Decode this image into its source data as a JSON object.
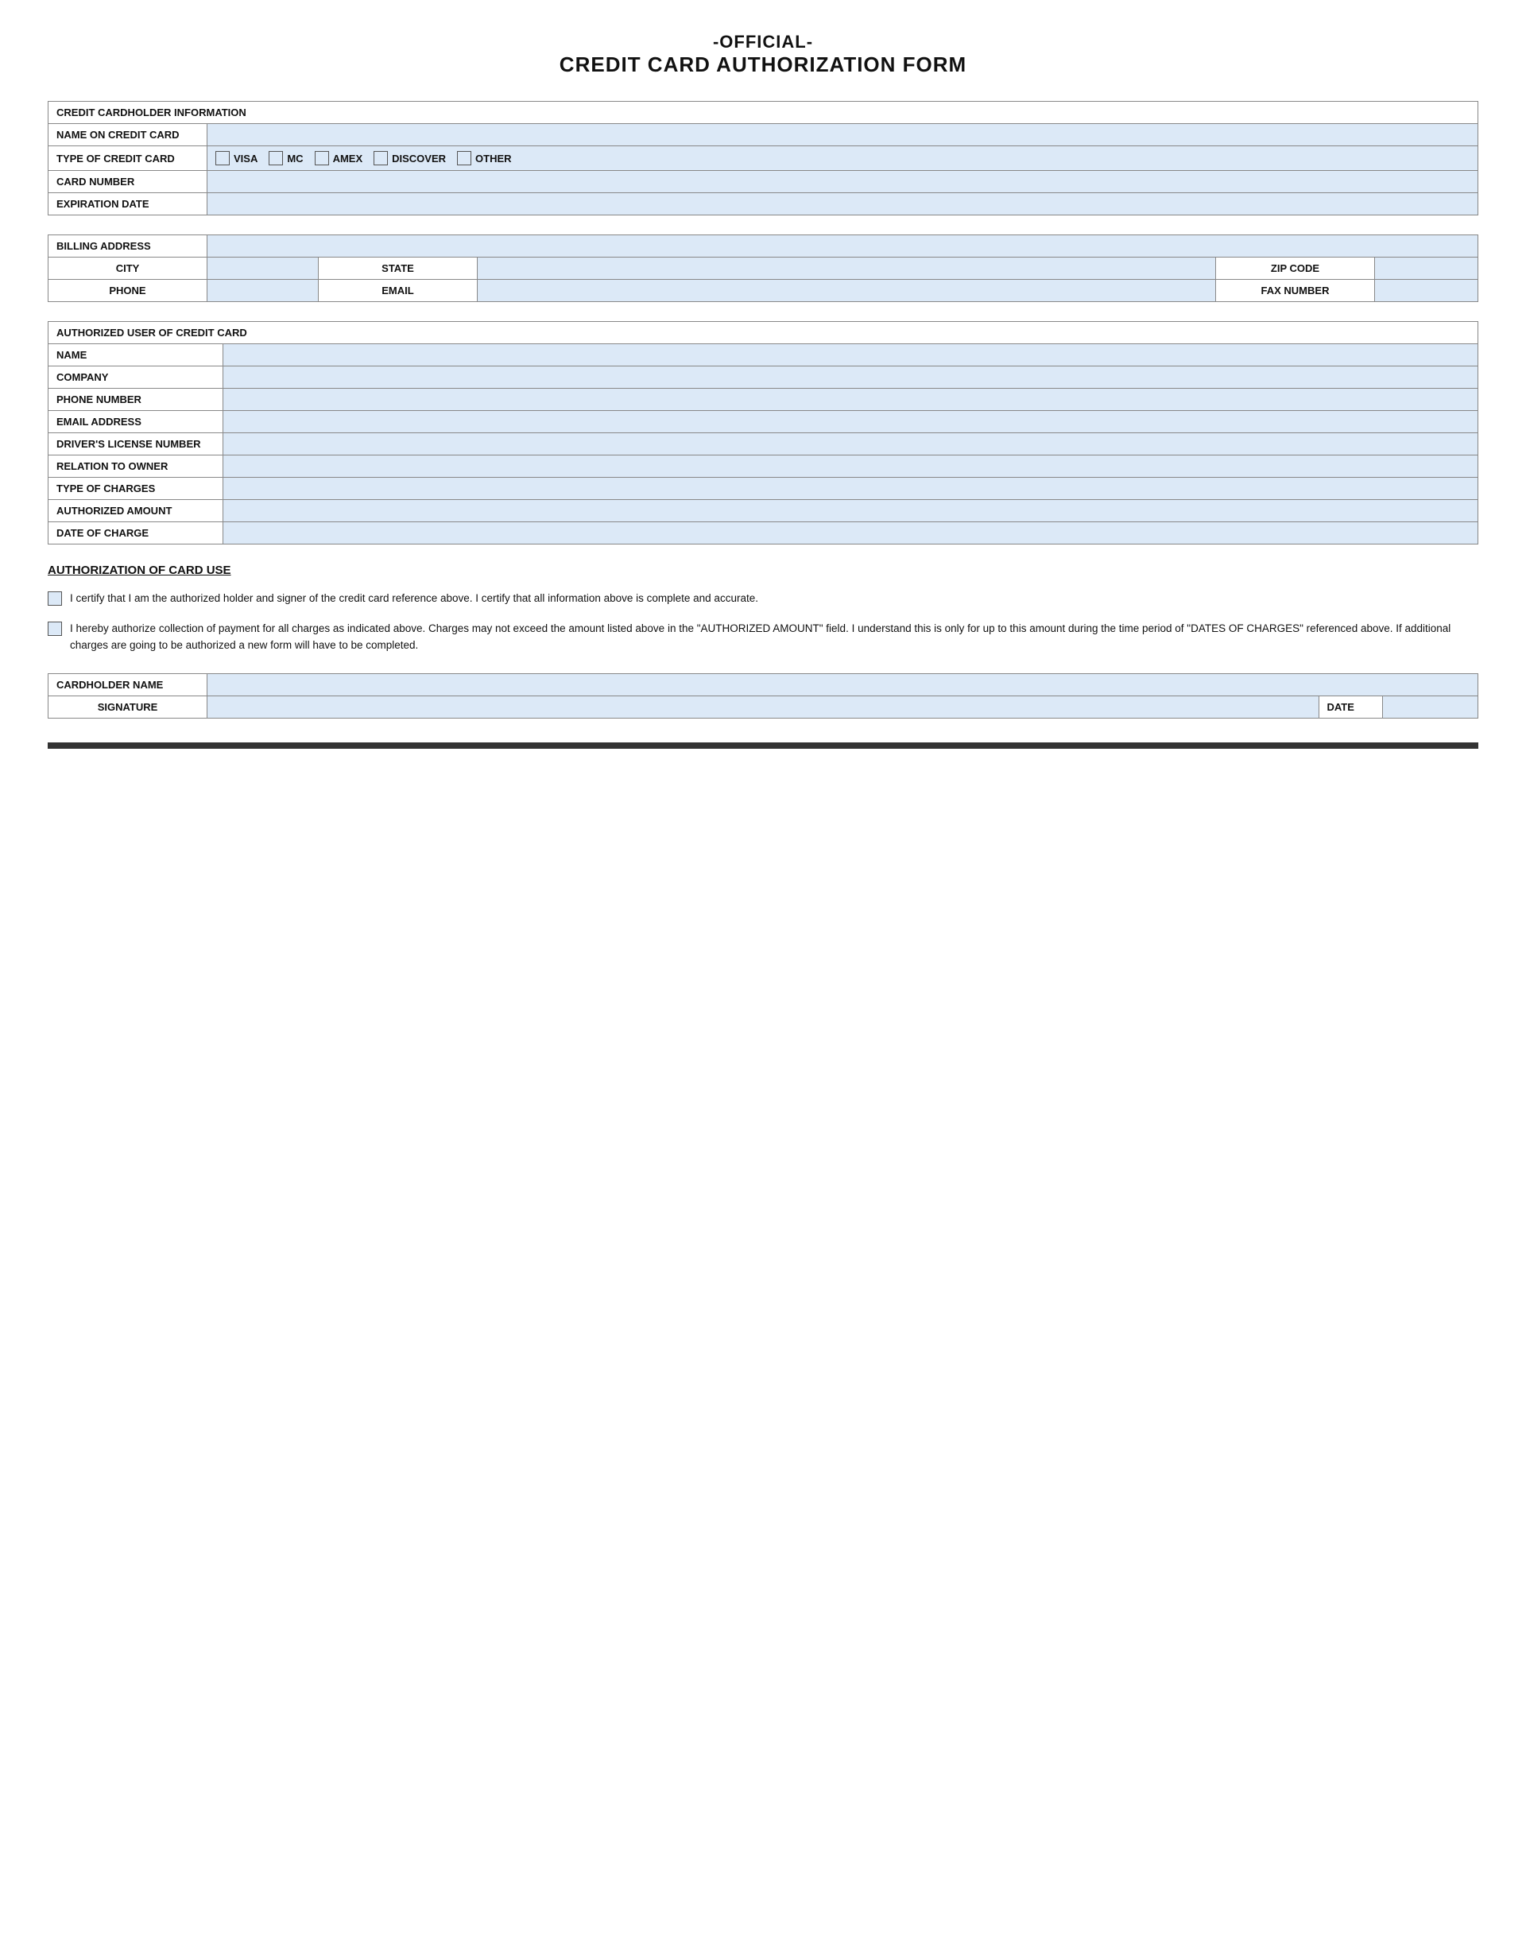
{
  "title": {
    "official": "-OFFICIAL-",
    "main": "CREDIT CARD AUTHORIZATION FORM"
  },
  "section1": {
    "header": "CREDIT CARDHOLDER INFORMATION",
    "rows": [
      {
        "label": "NAME ON CREDIT CARD",
        "value": ""
      },
      {
        "label": "TYPE OF CREDIT CARD",
        "special": "cc_type"
      },
      {
        "label": "CARD NUMBER",
        "value": ""
      },
      {
        "label": "EXPIRATION DATE",
        "value": ""
      }
    ],
    "cc_options": [
      "VISA",
      "MC",
      "AMEX",
      "DISCOVER",
      "OTHER"
    ]
  },
  "section2": {
    "header": "BILLING ADDRESS",
    "rows": [
      {
        "type": "address_row"
      },
      {
        "type": "city_state_zip"
      },
      {
        "type": "phone_email_fax"
      }
    ]
  },
  "section2_labels": {
    "billing_address": "BILLING ADDRESS",
    "city": "CITY",
    "state": "STATE",
    "zip": "ZIP CODE",
    "phone": "PHONE",
    "email": "EMAIL",
    "fax": "FAX NUMBER"
  },
  "section3": {
    "header": "AUTHORIZED USER OF CREDIT CARD",
    "rows": [
      "NAME",
      "COMPANY",
      "PHONE NUMBER",
      "EMAIL ADDRESS",
      "DRIVER'S LICENSE NUMBER",
      "RELATION TO OWNER",
      "TYPE OF CHARGES",
      "AUTHORIZED AMOUNT",
      "DATE OF CHARGE"
    ]
  },
  "auth": {
    "title": "AUTHORIZATION OF CARD USE",
    "para1": "I certify that I am the authorized holder and signer of the credit card reference above. I certify that all information above is complete and accurate.",
    "para2": "I hereby authorize collection of payment for all charges as indicated above. Charges may not exceed the amount listed above in the \"AUTHORIZED AMOUNT\" field. I understand this is only for up to this amount during the time period of \"DATES OF CHARGES\" referenced above. If additional charges are going to be authorized a new form will have to be completed."
  },
  "section4": {
    "rows": [
      {
        "label": "CARDHOLDER NAME",
        "value": ""
      },
      {
        "label_left": "SIGNATURE",
        "value_left": "",
        "label_right": "DATE",
        "value_right": ""
      }
    ]
  }
}
